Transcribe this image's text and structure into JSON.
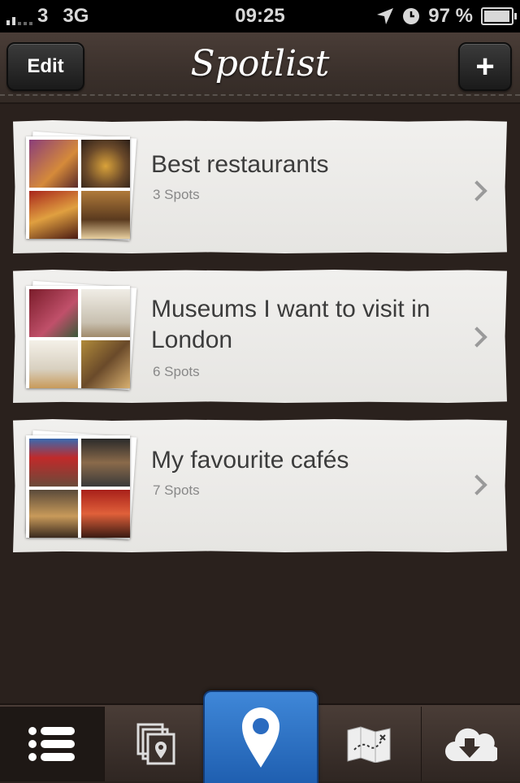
{
  "status_bar": {
    "carrier": "3",
    "network": "3G",
    "time": "09:25",
    "battery": "97 %",
    "battery_level": 0.97
  },
  "navbar": {
    "edit_label": "Edit",
    "title": "Spotlist",
    "add_label": "+"
  },
  "lists": [
    {
      "title": "Best restaurants",
      "count": "3 Spots"
    },
    {
      "title": "Museums I want to visit in London",
      "count": "6 Spots"
    },
    {
      "title": "My favourite cafés",
      "count": "7 Spots"
    }
  ],
  "tabbar": {
    "selected_tab": "spot",
    "accent_color": "#2f72c8",
    "icons": [
      "list-icon",
      "photo-stack-icon",
      "map-pin-icon",
      "map-icon",
      "cloud-download-icon"
    ]
  }
}
